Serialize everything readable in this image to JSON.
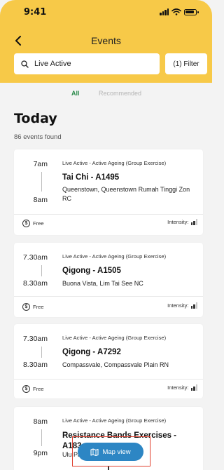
{
  "status_bar": {
    "time": "9:41"
  },
  "nav": {
    "title": "Events",
    "back_icon": "chevron-left-icon"
  },
  "search": {
    "value": "Live Active",
    "placeholder": "Search"
  },
  "filter": {
    "label": "(1) Filter"
  },
  "tabs": [
    {
      "label": "All",
      "active": true
    },
    {
      "label": "Recommended",
      "active": false
    }
  ],
  "section": {
    "title": "Today",
    "count": "86 events found"
  },
  "events": [
    {
      "start": "7am",
      "end": "8am",
      "category": "Live Active - Active Ageing (Group Exercise)",
      "title": "Tai Chi - A1495",
      "location": "Queenstown, Queenstown Rumah Tinggi Zon RC",
      "price": "Free",
      "intensity_label": "Intensity:",
      "intensity_level": 2
    },
    {
      "start": "7.30am",
      "end": "8.30am",
      "category": "Live Active - Active Ageing (Group Exercise)",
      "title": "Qigong - A1505",
      "location": "Buona Vista, Lim Tai See NC",
      "price": "Free",
      "intensity_label": "Intensity:",
      "intensity_level": 2
    },
    {
      "start": "7.30am",
      "end": "8.30am",
      "category": "Live Active - Active Ageing (Group Exercise)",
      "title": "Qigong - A7292",
      "location": "Compassvale, Compassvale Plain RN",
      "price": "Free",
      "intensity_label": "Intensity:",
      "intensity_level": 2
    },
    {
      "start": "8am",
      "end": "9pm",
      "category": "Live Active - Active Ageing (Group Exercise)",
      "title": "Resistance Bands Exercises - A183",
      "location": "Ulu Pa... ...k RN",
      "price": "",
      "intensity_label": "",
      "intensity_level": 0
    }
  ],
  "map_view": {
    "label": "Map view",
    "icon": "map-icon"
  },
  "colors": {
    "header": "#f7c948",
    "accent_green": "#2a8a4a",
    "map_button": "#2d86c4",
    "highlight": "#e0402f"
  }
}
